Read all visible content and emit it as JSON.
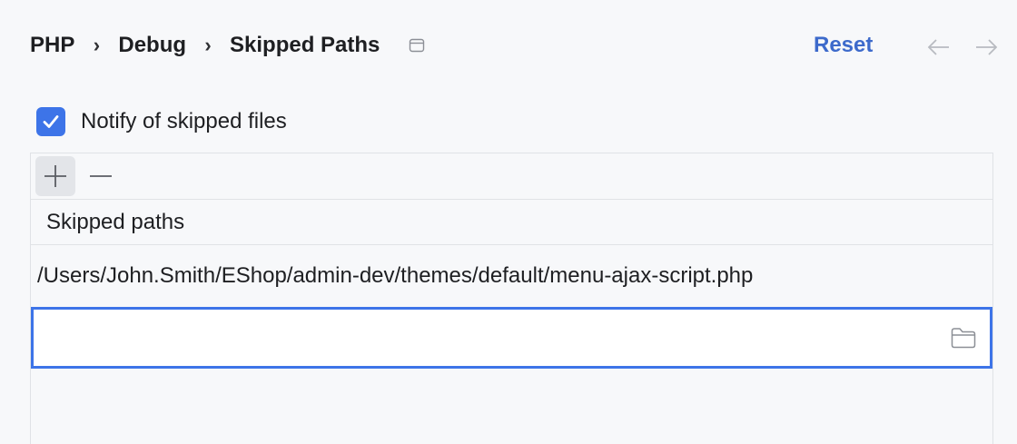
{
  "breadcrumb": {
    "items": [
      "PHP",
      "Debug",
      "Skipped Paths"
    ],
    "separator": "›"
  },
  "header": {
    "reset_label": "Reset",
    "pin_icon": "window-pin-icon",
    "back_icon": "arrow-left-icon",
    "forward_icon": "arrow-right-icon"
  },
  "notify": {
    "label": "Notify of skipped files",
    "checked": true
  },
  "toolbar": {
    "add_icon": "plus-icon",
    "remove_icon": "minus-icon"
  },
  "table": {
    "column_header": "Skipped paths",
    "rows": [
      "/Users/John.Smith/EShop/admin-dev/themes/default/menu-ajax-script.php"
    ],
    "edit_value": "",
    "browse_icon": "folder-icon"
  },
  "colors": {
    "accent": "#3d74e8",
    "link": "#3d6acb",
    "background": "#f7f8fa"
  }
}
